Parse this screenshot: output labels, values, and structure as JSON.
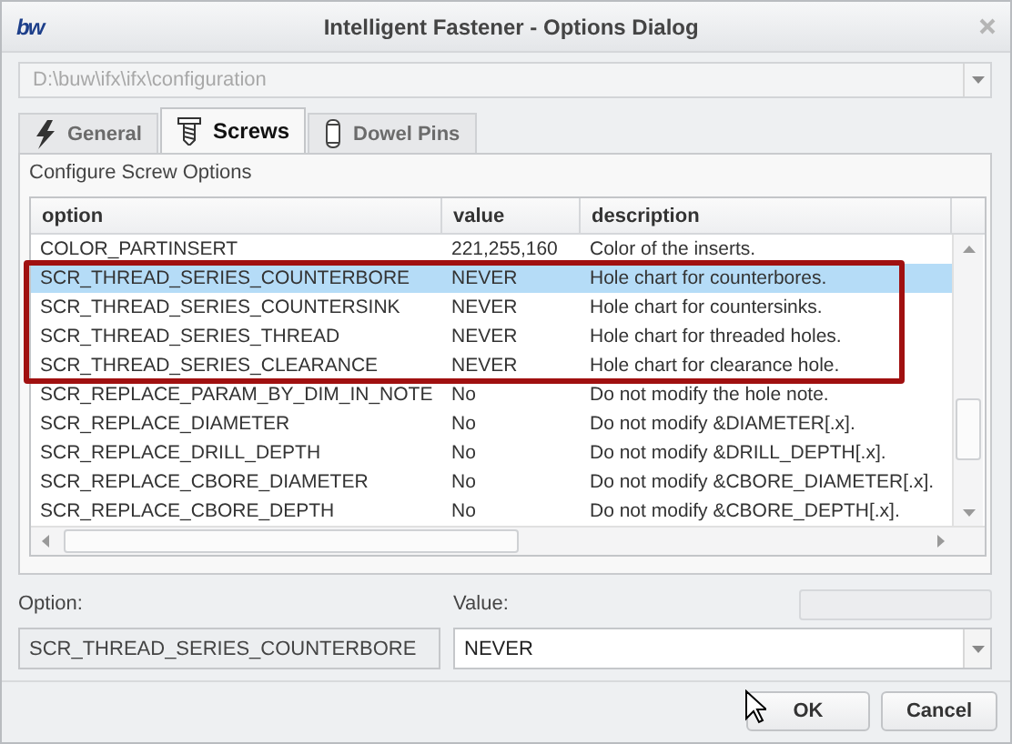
{
  "window": {
    "logo": "bw",
    "title": "Intelligent Fastener - Options Dialog"
  },
  "path_combo": {
    "value": "D:\\buw\\ifx\\ifx\\configuration",
    "disabled": true
  },
  "tabs": [
    {
      "label": "General",
      "kind": "bolt",
      "selected": false
    },
    {
      "label": "Screws",
      "kind": "screw",
      "selected": true
    },
    {
      "label": "Dowel Pins",
      "kind": "pin",
      "selected": false
    }
  ],
  "panel": {
    "heading": "Configure Screw Options"
  },
  "table": {
    "columns": [
      "option",
      "value",
      "description"
    ],
    "rows": [
      {
        "option": "COLOR_PARTINSERT",
        "value": "221,255,160",
        "description": "Color of the inserts.",
        "selected": false,
        "highlighted": false
      },
      {
        "option": "SCR_THREAD_SERIES_COUNTERBORE",
        "value": "NEVER",
        "description": "Hole chart for counterbores.",
        "selected": true,
        "highlighted": true
      },
      {
        "option": "SCR_THREAD_SERIES_COUNTERSINK",
        "value": "NEVER",
        "description": "Hole chart for countersinks.",
        "selected": false,
        "highlighted": true
      },
      {
        "option": "SCR_THREAD_SERIES_THREAD",
        "value": "NEVER",
        "description": "Hole chart for threaded holes.",
        "selected": false,
        "highlighted": true
      },
      {
        "option": "SCR_THREAD_SERIES_CLEARANCE",
        "value": "NEVER",
        "description": "Hole chart for clearance hole.",
        "selected": false,
        "highlighted": true
      },
      {
        "option": "SCR_REPLACE_PARAM_BY_DIM_IN_NOTE",
        "value": "No",
        "description": "Do not modify the hole note.",
        "selected": false,
        "highlighted": false
      },
      {
        "option": "SCR_REPLACE_DIAMETER",
        "value": "No",
        "description": "Do not modify &DIAMETER[.x].",
        "selected": false,
        "highlighted": false
      },
      {
        "option": "SCR_REPLACE_DRILL_DEPTH",
        "value": "No",
        "description": "Do not modify &DRILL_DEPTH[.x].",
        "selected": false,
        "highlighted": false
      },
      {
        "option": "SCR_REPLACE_CBORE_DIAMETER",
        "value": "No",
        "description": "Do not modify &CBORE_DIAMETER[.x].",
        "selected": false,
        "highlighted": false
      },
      {
        "option": "SCR_REPLACE_CBORE_DEPTH",
        "value": "No",
        "description": "Do not modify &CBORE_DEPTH[.x].",
        "selected": false,
        "highlighted": false
      }
    ]
  },
  "option_field": {
    "label": "Option:",
    "value": "SCR_THREAD_SERIES_COUNTERBORE"
  },
  "value_field": {
    "label": "Value:",
    "value": "NEVER"
  },
  "buttons": [
    {
      "label": "OK"
    },
    {
      "label": "Cancel"
    }
  ]
}
